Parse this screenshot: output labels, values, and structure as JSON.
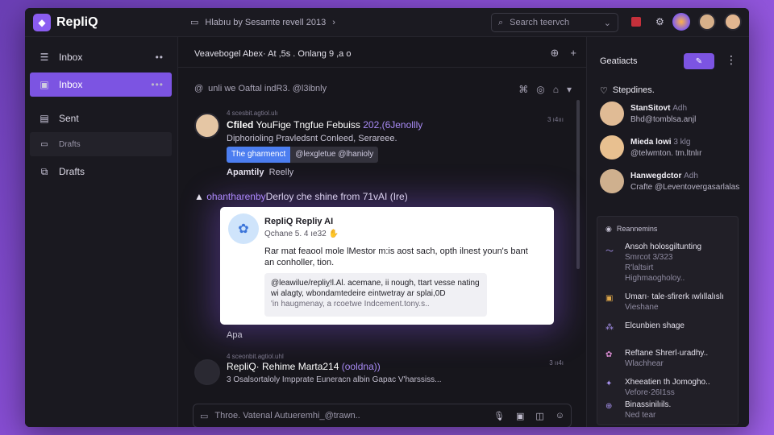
{
  "app": {
    "name": "RepliQ"
  },
  "topbar": {
    "message": "Hlabıu by Sesamte revell 2013",
    "search_placeholder": "Search teervch"
  },
  "sidebar": {
    "items": [
      {
        "label": "Inbox",
        "icon": "inbox-icon"
      },
      {
        "label": "Inbox",
        "icon": "inbox-icon"
      },
      {
        "label": "Sent",
        "icon": "sent-icon"
      },
      {
        "label": "Drafts",
        "icon": "drafts-icon"
      },
      {
        "label": "Drafts",
        "icon": "drafts-icon"
      }
    ]
  },
  "middle": {
    "header_title": "Veavebogel Abex·  At ,5s . Onlang 9 ,a o",
    "thread_label": "unli we Oaftal indR3. @l3ibnly",
    "message1": {
      "meta": "4 scesbit.agtiol.ulı",
      "name": "Cfiled",
      "subject": "YouFige Tngfue Febuiss",
      "link": "202,(6Jenollly",
      "line": "Diphorioling  Pravledsnt Conleed, Serareee.",
      "chip_a": "The gharmenct",
      "chip_b": "@lexgletue @lhanioly",
      "footer_name": "Apamtily",
      "footer_text": "Reelly",
      "timestamp": "3 ı4ııı"
    },
    "mention": {
      "pre": "ohantharenby",
      "text": "Derloy che shine from 71vAI (Ire)"
    },
    "ai_card": {
      "title": "RepliQ Repliy AI",
      "subtitle": "Qchane 5. 4 ıe32 ",
      "body": "Rar mat feaool mole lMestor m:is aost sach, opth ilnest youn's bant an conholler, tion.",
      "quote1": "@leawilue/repliỵ!l.Al. acemane, ii nough, ttart vesse nating",
      "quote2": "wi alagty,  wbondamtedeire eintwetray ar splai,0D",
      "quote3": "'in haugmenay, a rcoetwe Indcement.tony.s.."
    },
    "after_card": "Apa",
    "message2": {
      "meta": "4 sceonbit.agtiol.uhl",
      "name": "RepliQ·  Rehime Marta214",
      "link": "(ooldna))",
      "line": "3 Osalsortaloly Impprate Euneracn albin Gapac V'harssiss...",
      "timestamp": "3 ıı4ı"
    },
    "composer_placeholder": "Throe. Vatenal Autueremhi_@trawn.."
  },
  "right": {
    "header": "Geatiacts",
    "section": "Stepdines.",
    "contacts": [
      {
        "name": "StanSitovt",
        "tag": "Adh",
        "status": "Bhd@tomblsa.anjl"
      },
      {
        "name": "Mieda lowi",
        "tag": "3 klg",
        "status": "@telwmton.  tm.ltnlır"
      },
      {
        "name": "Hanwegdctor",
        "tag": "Adh",
        "status": "Crafte @Leventovergasarlalas"
      }
    ],
    "panel_title": "Reannemins",
    "panel_items": [
      {
        "title": "Ansoh holosgiltunting",
        "sub1": "Smrcot 3/323",
        "sub2": "R'laltsirt",
        "sub3": "Highmaogholoy.."
      },
      {
        "title": "Umarı· tale·sfirerk ıwlıllalıslı",
        "sub1": "Vieshane"
      },
      {
        "title": "Elcunbien shage"
      },
      {
        "title": "Reftane Shrerl·uradhy..",
        "sub1": "Wlachhear"
      },
      {
        "title": "Xheeatien th Jomogho..",
        "sub1": "Vefore·26I1ss"
      },
      {
        "title": "Binassinilıils.",
        "sub1": "Ned tear"
      }
    ]
  },
  "colors": {
    "accent": "#7c54e2",
    "link": "#a98bf6",
    "chip_blue": "#4c7ef0",
    "background_purple": "#8a4fd6"
  }
}
